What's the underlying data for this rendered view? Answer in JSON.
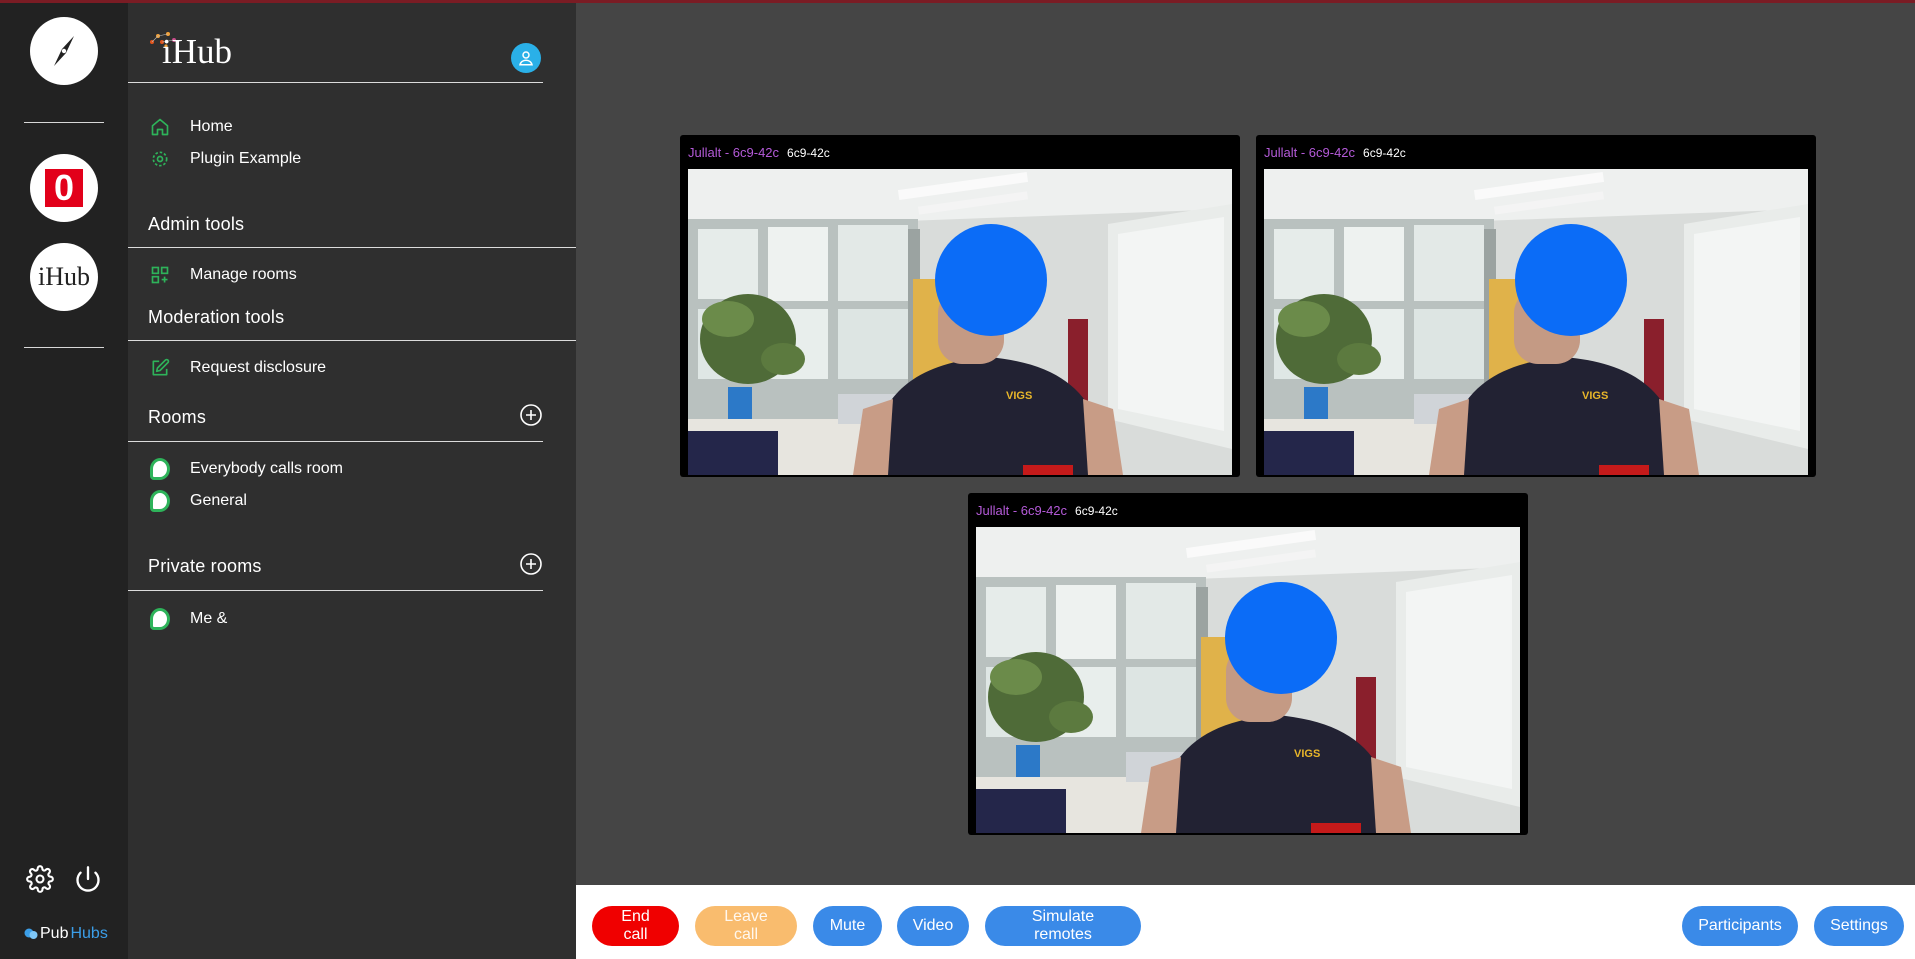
{
  "app": {
    "hub_title": "iHub",
    "rail_badge": "0",
    "rail_hub_label": "iHub",
    "brand_pub": "Pub",
    "brand_hubs": "Hubs"
  },
  "sidebar": {
    "nav": [
      {
        "label": "Home",
        "icon": "home-icon"
      },
      {
        "label": "Plugin Example",
        "icon": "gear-icon"
      }
    ],
    "admin": {
      "title": "Admin tools",
      "items": [
        {
          "label": "Manage rooms",
          "icon": "manage-rooms-icon"
        }
      ]
    },
    "moderation": {
      "title": "Moderation tools",
      "items": [
        {
          "label": "Request disclosure",
          "icon": "edit-icon"
        }
      ]
    },
    "rooms": {
      "title": "Rooms",
      "items": [
        {
          "label": "Everybody calls room"
        },
        {
          "label": "General"
        }
      ]
    },
    "private_rooms": {
      "title": "Private rooms",
      "items": [
        {
          "label": "Me &"
        }
      ]
    }
  },
  "call": {
    "participants": [
      {
        "name": "Jullalt - 6c9-42c",
        "id": "6c9-42c"
      },
      {
        "name": "Jullalt - 6c9-42c",
        "id": "6c9-42c"
      },
      {
        "name": "Jullalt - 6c9-42c",
        "id": "6c9-42c"
      }
    ],
    "shirt_text": "VIGS"
  },
  "controls": {
    "end_call": "End call",
    "leave_call": "Leave call",
    "mute": "Mute",
    "video": "Video",
    "simulate_remotes": "Simulate remotes",
    "participants": "Participants",
    "settings": "Settings"
  },
  "colors": {
    "accent_green": "#2eb35a",
    "participant_name": "#b45ad8",
    "end_call": "#f00000",
    "leave_call": "#f9bc6e",
    "primary_button": "#3a8ae8",
    "avatar": "#2ab0e8"
  }
}
